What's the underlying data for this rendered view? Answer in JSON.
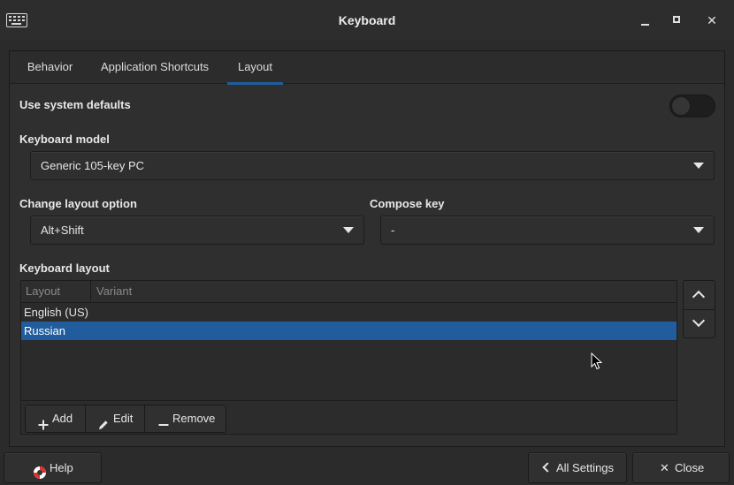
{
  "window": {
    "title": "Keyboard",
    "icon": "keyboard-icon",
    "minimize_glyph": "",
    "close_glyph": "✕"
  },
  "tabs": [
    {
      "label": "Behavior",
      "active": false
    },
    {
      "label": "Application Shortcuts",
      "active": false
    },
    {
      "label": "Layout",
      "active": true
    }
  ],
  "layout_page": {
    "use_system_defaults": {
      "label": "Use system defaults",
      "enabled": false
    },
    "keyboard_model": {
      "label": "Keyboard model",
      "value": "Generic 105-key PC"
    },
    "change_layout_option": {
      "label": "Change layout option",
      "value": "Alt+Shift"
    },
    "compose_key": {
      "label": "Compose key",
      "value": "-"
    },
    "keyboard_layout": {
      "label": "Keyboard layout",
      "columns": [
        "Layout",
        "Variant"
      ],
      "rows": [
        {
          "layout": "English (US)",
          "variant": "",
          "selected": false
        },
        {
          "layout": "Russian",
          "variant": "",
          "selected": true
        }
      ],
      "toolbar": {
        "add_label": "Add",
        "edit_label": "Edit",
        "remove_label": "Remove"
      }
    }
  },
  "footer": {
    "help_label": "Help",
    "all_settings_label": "All Settings",
    "close_label": "Close"
  },
  "colors": {
    "accent": "#215d9c",
    "background": "#2b2b2b",
    "text": "#e6e6e6"
  }
}
